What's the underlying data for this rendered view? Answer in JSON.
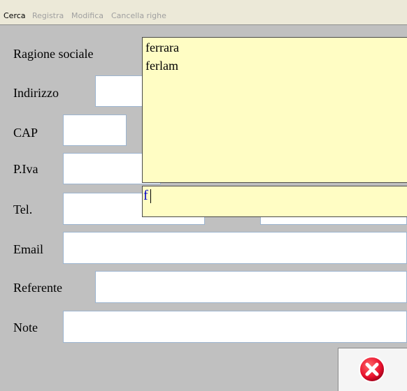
{
  "menu": {
    "items": [
      {
        "label": "Cerca",
        "enabled": true
      },
      {
        "label": "Registra",
        "enabled": false
      },
      {
        "label": "Modifica",
        "enabled": false
      },
      {
        "label": "Cancella righe",
        "enabled": false
      }
    ]
  },
  "form": {
    "ragione_sociale_label": "Ragione sociale",
    "indirizzo_label": "Indirizzo",
    "cap_label": "CAP",
    "piva_label": "P.Iva",
    "tel_label": "Tel.",
    "email_label": "Email",
    "referente_label": "Referente",
    "note_label": "Note"
  },
  "autocomplete": {
    "options": [
      "ferrara",
      "ferlam"
    ],
    "query": "f"
  },
  "icons": {
    "close": "close-circle-icon"
  },
  "colors": {
    "dropdown_bg": "#fffdc4",
    "close_red": "#e8112d",
    "field_border": "#9cb4cf"
  }
}
